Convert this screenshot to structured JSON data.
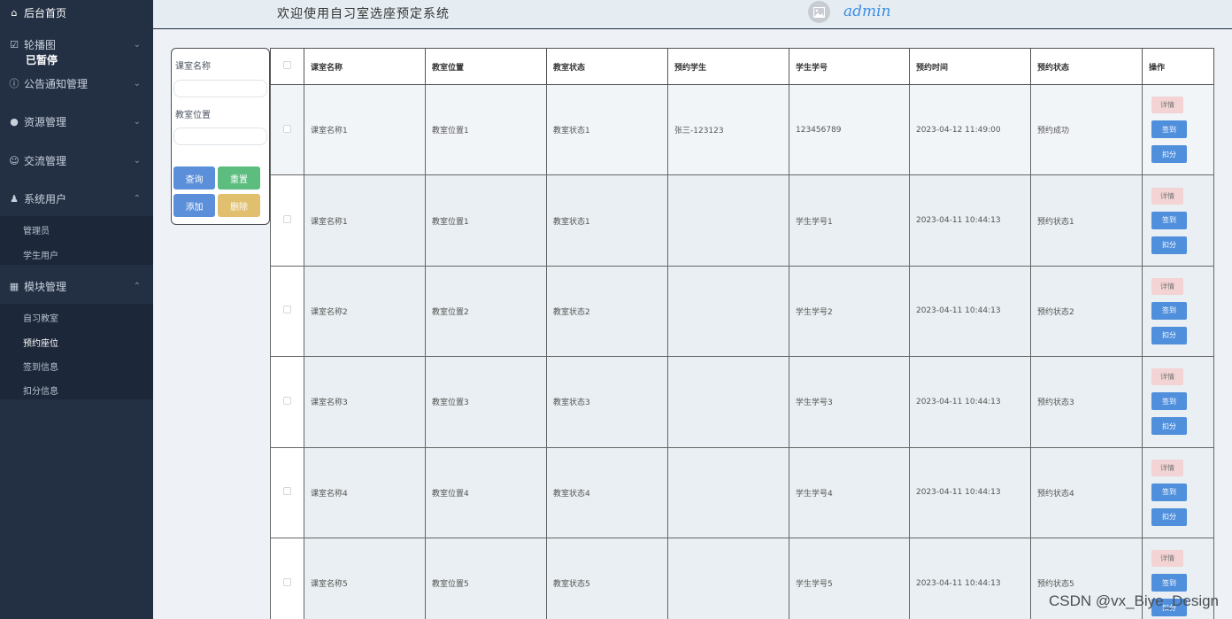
{
  "sidebar": {
    "home": "后台首页",
    "carousel": "轮播图",
    "paused": "已暂停",
    "notice": "公告通知管理",
    "resources": "资源管理",
    "exchange": "交流管理",
    "system_users": "系统用户",
    "system_users_sub": [
      "管理员",
      "学生用户"
    ],
    "modules": "模块管理",
    "modules_sub": [
      "自习教室",
      "预约座位",
      "签到信息",
      "扣分信息"
    ]
  },
  "header": {
    "welcome": "欢迎使用自习室选座预定系统",
    "username": "admin"
  },
  "search": {
    "classroom_name_label": "课室名称",
    "classroom_location_label": "教室位置",
    "query_button": "查询",
    "reset_button": "重置",
    "add_button": "添加",
    "delete_button": "删除"
  },
  "table": {
    "headers": [
      "课室名称",
      "教室位置",
      "教室状态",
      "预约学生",
      "学生学号",
      "预约时间",
      "预约状态",
      "操作"
    ],
    "rows": [
      {
        "name": "课室名称1",
        "location": "教室位置1",
        "status": "教室状态1",
        "student": "张三-123123",
        "student_no": "123456789",
        "time": "2023-04-12 11:49:00",
        "reserve_status": "预约成功"
      },
      {
        "name": "课室名称1",
        "location": "教室位置1",
        "status": "教室状态1",
        "student": "",
        "student_no": "学生学号1",
        "time": "2023-04-11 10:44:13",
        "reserve_status": "预约状态1"
      },
      {
        "name": "课室名称2",
        "location": "教室位置2",
        "status": "教室状态2",
        "student": "",
        "student_no": "学生学号2",
        "time": "2023-04-11 10:44:13",
        "reserve_status": "预约状态2"
      },
      {
        "name": "课室名称3",
        "location": "教室位置3",
        "status": "教室状态3",
        "student": "",
        "student_no": "学生学号3",
        "time": "2023-04-11 10:44:13",
        "reserve_status": "预约状态3"
      },
      {
        "name": "课室名称4",
        "location": "教室位置4",
        "status": "教室状态4",
        "student": "",
        "student_no": "学生学号4",
        "time": "2023-04-11 10:44:13",
        "reserve_status": "预约状态4"
      },
      {
        "name": "课室名称5",
        "location": "教室位置5",
        "status": "教室状态5",
        "student": "",
        "student_no": "学生学号5",
        "time": "2023-04-11 10:44:13",
        "reserve_status": "预约状态5"
      }
    ],
    "ops": {
      "detail": "详情",
      "sign": "签到",
      "deduct": "扣分"
    }
  },
  "watermark": "CSDN @vx_Biye_Design"
}
